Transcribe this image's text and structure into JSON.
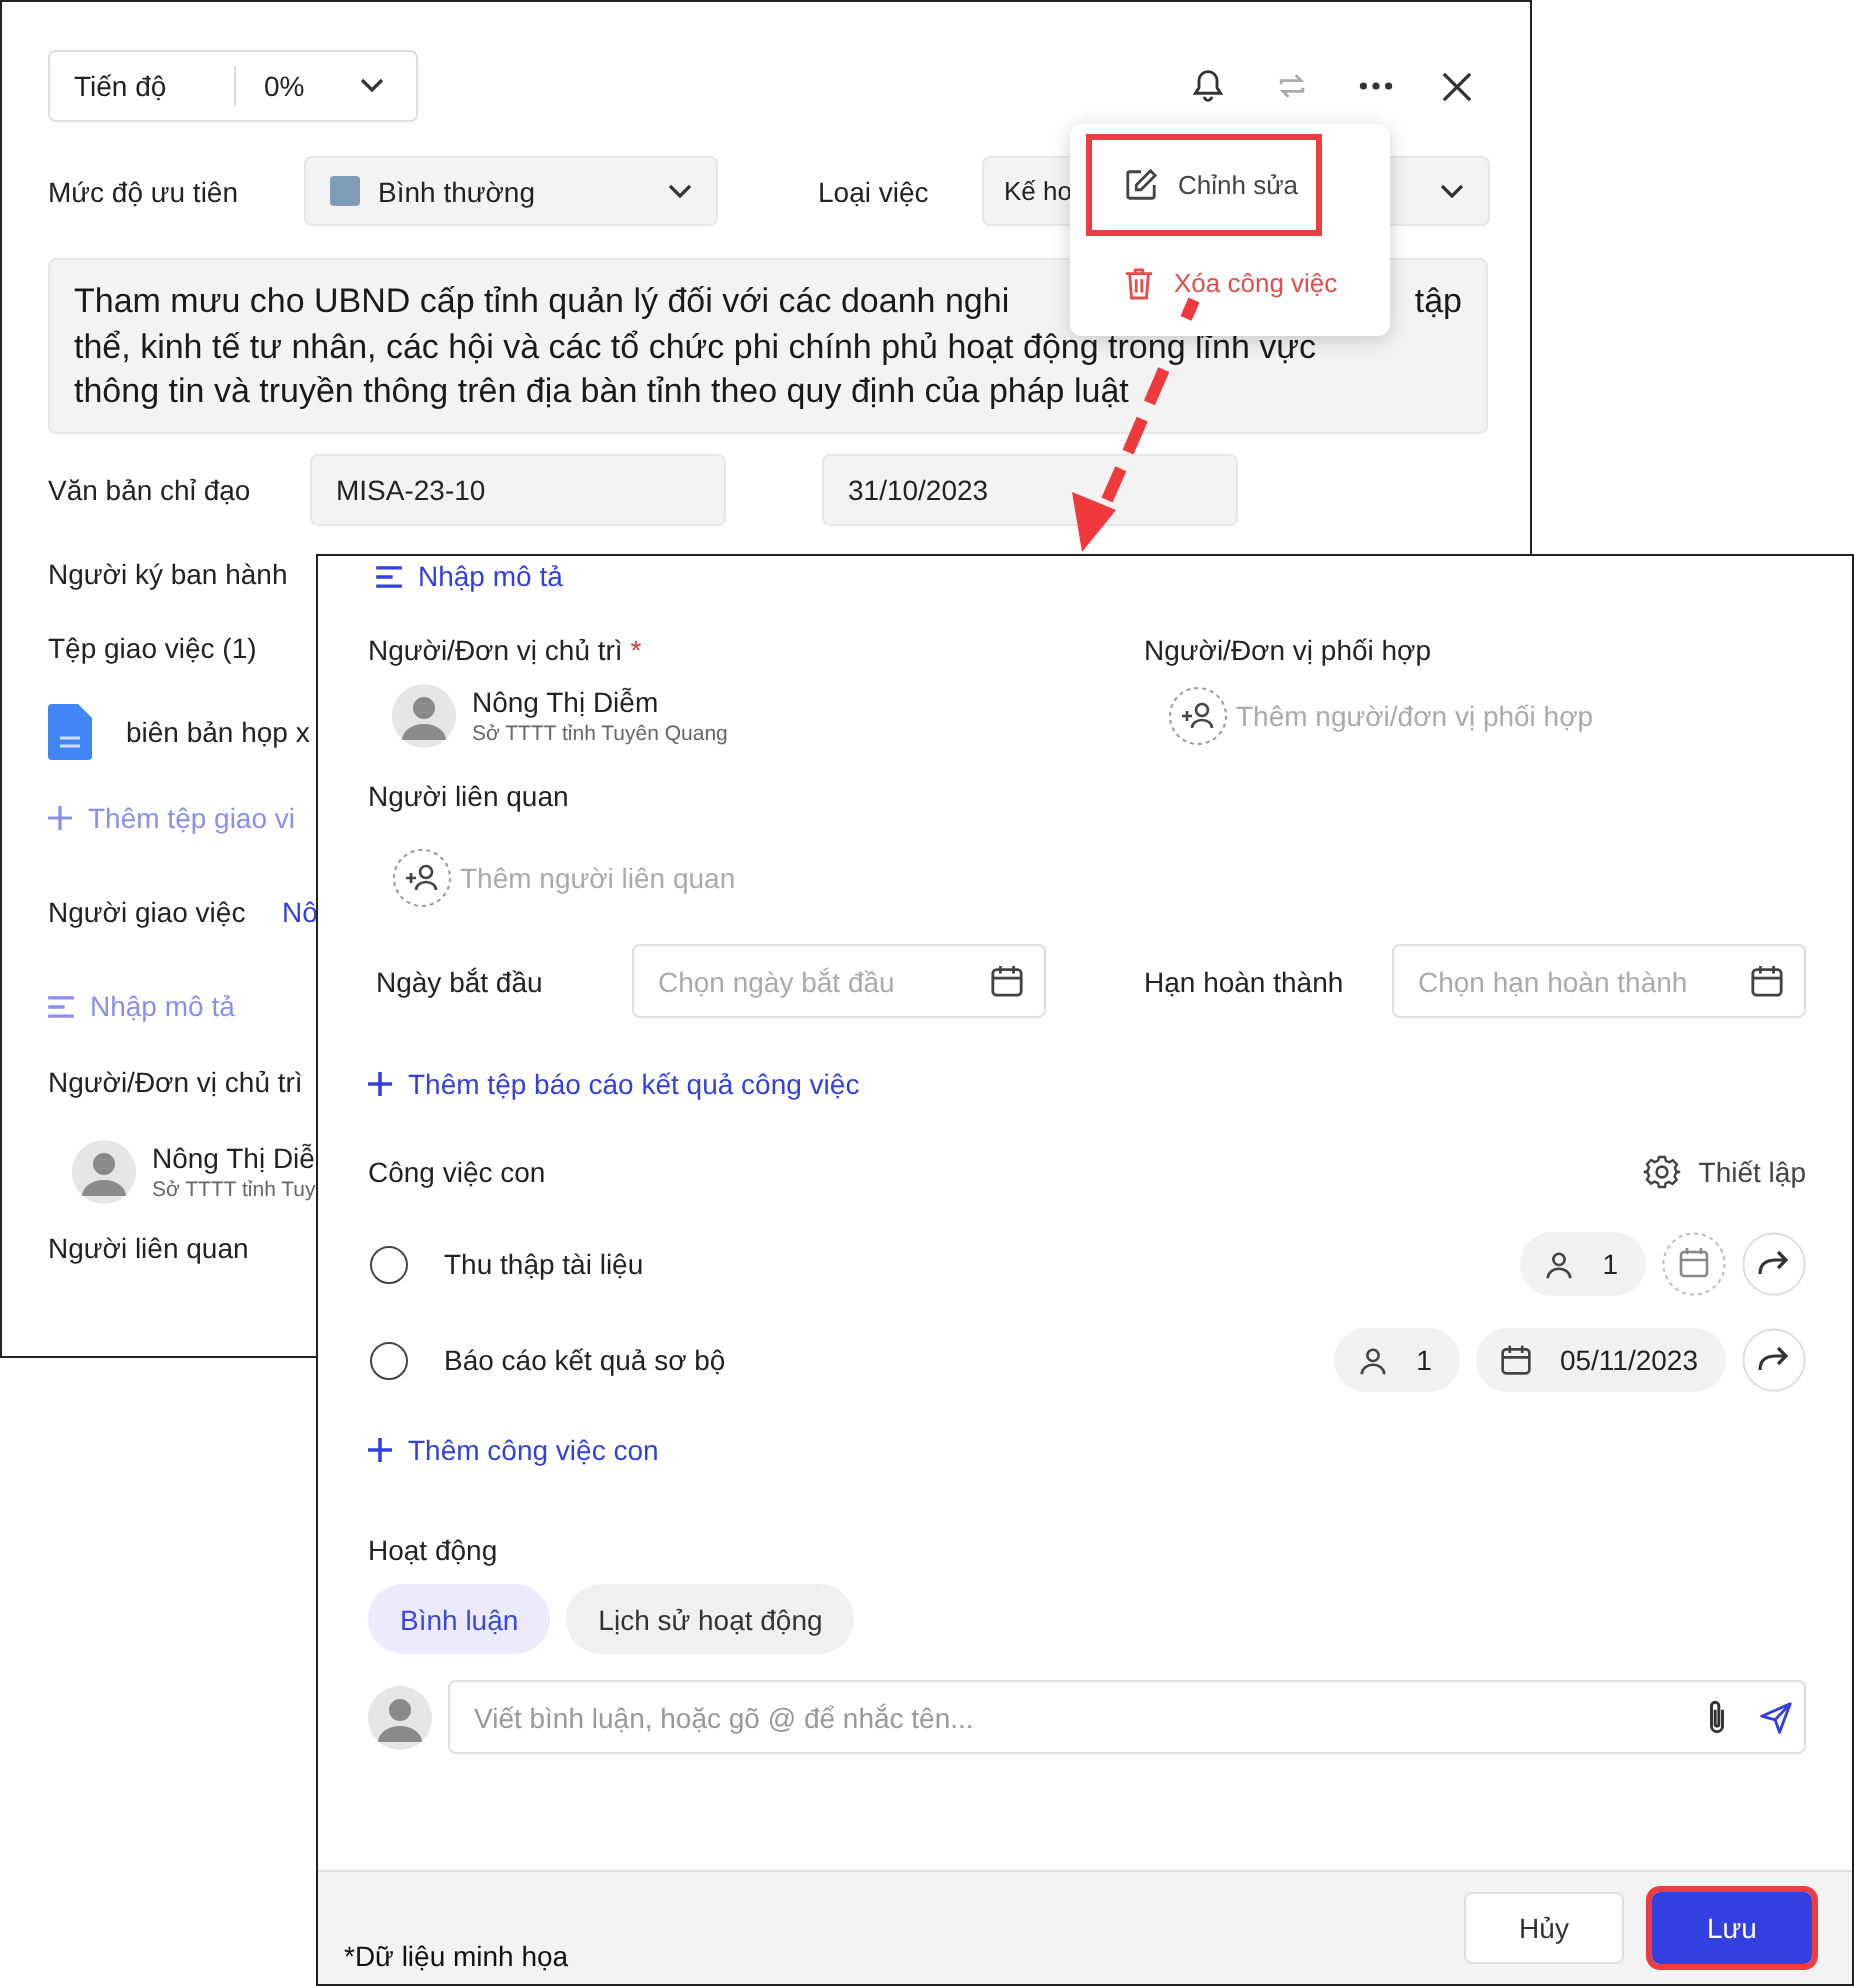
{
  "task_panel": {
    "progress": {
      "label": "Tiến độ",
      "value": "0%"
    },
    "priority": {
      "label": "Mức độ ưu tiên",
      "value": "Bình thường"
    },
    "task_type": {
      "label": "Loại việc",
      "value": "Kế ho"
    },
    "description": [
      {
        "text": "Tham mưu cho UBND cấp tỉnh quản lý đối với các doanh nghi",
        "tail": "tập"
      },
      {
        "text": "thể, kinh tế tư nhân, các hội và các tổ chức phi chính phủ hoạt động trong lĩnh vực"
      },
      {
        "text": "thông tin và truyền thông trên địa bàn tỉnh theo quy định của pháp luật"
      }
    ],
    "directive": {
      "label": "Văn bản chỉ đạo",
      "number": "MISA-23-10",
      "date": "31/10/2023"
    },
    "signer_label": "Người ký ban hành",
    "files": {
      "label": "Tệp giao việc (1)",
      "items": [
        "biên bản họp x"
      ],
      "add": "Thêm tệp giao vi"
    },
    "assigner": {
      "label": "Người giao việc",
      "value": "Nô"
    },
    "description_link": "Nhập mô tả",
    "owner": {
      "label": "Người/Đơn vị chủ trì",
      "name": "Nông Thị Diễ",
      "unit": "Sở TTTT tỉnh Tuy"
    },
    "related_label": "Người liên quan"
  },
  "menu": [
    {
      "kind": "edit",
      "label": "Chỉnh sửa",
      "highlighted": true
    },
    {
      "kind": "delete",
      "label": "Xóa công việc",
      "highlighted": false
    }
  ],
  "edit_form": {
    "description_link": "Nhập mô tả",
    "owner": {
      "label": "Người/Đơn vị chủ trì",
      "required_mark": "*",
      "name": "Nông Thị Diễm",
      "unit": "Sở TTTT tỉnh Tuyên Quang"
    },
    "collaborator": {
      "label": "Người/Đơn vị phối hợp",
      "placeholder": "Thêm người/đơn vị phối hợp"
    },
    "related": {
      "label": "Người liên quan",
      "placeholder": "Thêm người liên quan"
    },
    "start_date": {
      "label": "Ngày bắt đầu",
      "placeholder": "Chọn ngày bắt đầu"
    },
    "due_date": {
      "label": "Hạn hoàn thành",
      "placeholder": "Chọn hạn hoàn thành"
    },
    "add_report": "Thêm tệp báo cáo kết quả công việc",
    "subtasks": {
      "title": "Công việc con",
      "settings": "Thiết lập",
      "items": [
        {
          "title": "Thu thập tài liệu",
          "checked": false,
          "assignees": "1"
        },
        {
          "title": "Báo cáo kết quả sơ bộ",
          "checked": false,
          "assignees": "1",
          "due": "05/11/2023"
        }
      ],
      "add": "Thêm công việc con"
    },
    "activity": {
      "title": "Hoạt động",
      "tabs": [
        {
          "label": "Bình luận",
          "selected": true
        },
        {
          "label": "Lịch sử hoạt động",
          "selected": false
        }
      ],
      "comment_placeholder": "Viết bình luận, hoặc gõ @ để nhắc tên..."
    },
    "note": "*Dữ liệu minh họa",
    "buttons": [
      {
        "kind": "cancel",
        "label": "Hủy",
        "highlighted": false
      },
      {
        "kind": "save",
        "label": "Lưu",
        "highlighted": true
      }
    ]
  }
}
